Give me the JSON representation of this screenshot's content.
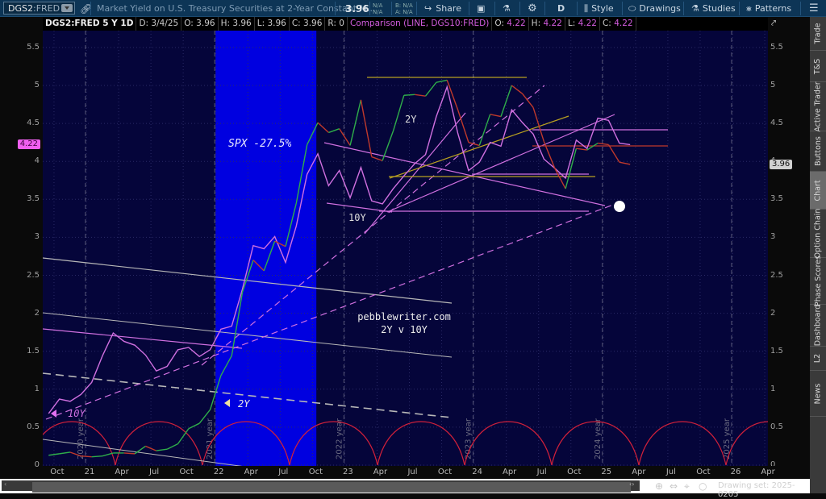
{
  "toolbar": {
    "symbol": "DGS2",
    "symbol_suffix": ":FRED",
    "description": "Market Yield on U.S. Treasury Securities at 2-Year Constant M...",
    "last_price": "3.96",
    "change_top": "N/A",
    "change_bottom": "N/A",
    "bid": "B: N/A",
    "ask": "A: N/A",
    "share_label": "Share",
    "aggregation": "D",
    "style_label": "Style",
    "drawings_label": "Drawings",
    "studies_label": "Studies",
    "patterns_label": "Patterns"
  },
  "infoline": {
    "symbol_period": "DGS2:FRED 5 Y 1D",
    "date": "D: 3/4/25",
    "open": "O: 3.96",
    "high": "H: 3.96",
    "low": "L: 3.96",
    "close": "C: 3.96",
    "range": "R: 0",
    "comparison": "Comparison (LINE, DGS10:FRED)",
    "cmp_open_label": "O:",
    "cmp_open": "4.22",
    "cmp_high_label": "H:",
    "cmp_high": "4.22",
    "cmp_low_label": "L:",
    "cmp_low": "4.22",
    "cmp_close_label": "C:",
    "cmp_close": "4.22"
  },
  "colors": {
    "chart_bg": "#05053a",
    "highlight_band": "#0000e0",
    "up": "#2fae4a",
    "down": "#c0392b",
    "comparison": "#d070e0",
    "cycle_arcs": "#d0203a",
    "trend_gray": "#b8b8b8",
    "trend_gold": "#b8a020"
  },
  "chart_data": {
    "type": "line",
    "y_range": [
      0,
      5.75
    ],
    "y_ticks": [
      "5.5",
      "5",
      "4.5",
      "4",
      "3.5",
      "3",
      "2.5",
      "2",
      "1.5",
      "1",
      "0.5",
      "0"
    ],
    "x_ticks": [
      "Oct",
      "21",
      "Apr",
      "Jul",
      "Oct",
      "22",
      "Apr",
      "Jul",
      "Oct",
      "23",
      "Apr",
      "Jul",
      "Oct",
      "24",
      "Apr",
      "Jul",
      "Oct",
      "25",
      "Apr",
      "Jul",
      "Oct",
      "26",
      "Apr"
    ],
    "grid": true,
    "left_badge": "4.22",
    "right_badge": "3.96",
    "year_markers": [
      "2020 year",
      "2021 year",
      "2022 year",
      "2023 year",
      "2024 year",
      "2025 year"
    ],
    "series": [
      {
        "name": "DGS2:FRED",
        "dates": [
          "2020-09",
          "2020-10",
          "2020-11",
          "2020-12",
          "2021-01",
          "2021-02",
          "2021-03",
          "2021-04",
          "2021-05",
          "2021-06",
          "2021-07",
          "2021-08",
          "2021-09",
          "2021-10",
          "2021-11",
          "2021-12",
          "2022-01",
          "2022-02",
          "2022-03",
          "2022-04",
          "2022-05",
          "2022-06",
          "2022-07",
          "2022-08",
          "2022-09",
          "2022-10",
          "2022-11",
          "2022-12",
          "2023-01",
          "2023-02",
          "2023-03",
          "2023-04",
          "2023-05",
          "2023-06",
          "2023-07",
          "2023-08",
          "2023-09",
          "2023-10",
          "2023-11",
          "2023-12",
          "2024-01",
          "2024-02",
          "2024-03",
          "2024-04",
          "2024-05",
          "2024-06",
          "2024-07",
          "2024-08",
          "2024-09",
          "2024-10",
          "2024-11",
          "2024-12",
          "2025-01",
          "2025-02",
          "2025-03"
        ],
        "values": [
          0.13,
          0.15,
          0.17,
          0.12,
          0.11,
          0.12,
          0.16,
          0.16,
          0.15,
          0.25,
          0.19,
          0.21,
          0.28,
          0.48,
          0.55,
          0.73,
          1.18,
          1.44,
          2.28,
          2.7,
          2.56,
          2.95,
          2.88,
          3.45,
          4.22,
          4.51,
          4.38,
          4.43,
          4.21,
          4.81,
          4.06,
          4.01,
          4.4,
          4.87,
          4.88,
          4.86,
          5.04,
          5.07,
          4.68,
          4.25,
          4.21,
          4.62,
          4.59,
          5.0,
          4.89,
          4.71,
          4.26,
          3.91,
          3.64,
          4.17,
          4.15,
          4.24,
          4.22,
          3.99,
          3.96
        ]
      },
      {
        "name": "DGS10:FRED",
        "dates": [
          "2020-09",
          "2020-10",
          "2020-11",
          "2020-12",
          "2021-01",
          "2021-02",
          "2021-03",
          "2021-04",
          "2021-05",
          "2021-06",
          "2021-07",
          "2021-08",
          "2021-09",
          "2021-10",
          "2021-11",
          "2021-12",
          "2022-01",
          "2022-02",
          "2022-03",
          "2022-04",
          "2022-05",
          "2022-06",
          "2022-07",
          "2022-08",
          "2022-09",
          "2022-10",
          "2022-11",
          "2022-12",
          "2023-01",
          "2023-02",
          "2023-03",
          "2023-04",
          "2023-05",
          "2023-06",
          "2023-07",
          "2023-08",
          "2023-09",
          "2023-10",
          "2023-11",
          "2023-12",
          "2024-01",
          "2024-02",
          "2024-03",
          "2024-04",
          "2024-05",
          "2024-06",
          "2024-07",
          "2024-08",
          "2024-09",
          "2024-10",
          "2024-11",
          "2024-12",
          "2025-01",
          "2025-02",
          "2025-03"
        ],
        "values": [
          0.68,
          0.87,
          0.84,
          0.93,
          1.09,
          1.44,
          1.74,
          1.63,
          1.58,
          1.45,
          1.24,
          1.3,
          1.52,
          1.55,
          1.43,
          1.52,
          1.79,
          1.83,
          2.32,
          2.89,
          2.85,
          3.01,
          2.67,
          3.15,
          3.83,
          4.1,
          3.68,
          3.88,
          3.52,
          3.92,
          3.48,
          3.44,
          3.64,
          3.81,
          3.97,
          4.09,
          4.59,
          4.98,
          4.37,
          3.88,
          3.99,
          4.25,
          4.2,
          4.68,
          4.51,
          4.36,
          4.03,
          3.91,
          3.78,
          4.28,
          4.17,
          4.57,
          4.54,
          4.24,
          4.22
        ]
      }
    ]
  },
  "annotations": {
    "spx": "SPX -27.5%",
    "label_2y": "2Y",
    "label_10y": "10Y",
    "site": "pebblewriter.com",
    "subtitle": "2Y v 10Y",
    "marker_10y": "10Y",
    "marker_2y": "2Y"
  },
  "sidebar": {
    "tabs": [
      "Trade",
      "T&S",
      "Active Trader",
      "Buttons",
      "Chart",
      "Option Chain",
      "Phase Scores",
      "Dashboard",
      "L2",
      "News"
    ],
    "active": "Chart"
  },
  "footer": {
    "drawing_set": "Drawing set: 2025-0205"
  }
}
